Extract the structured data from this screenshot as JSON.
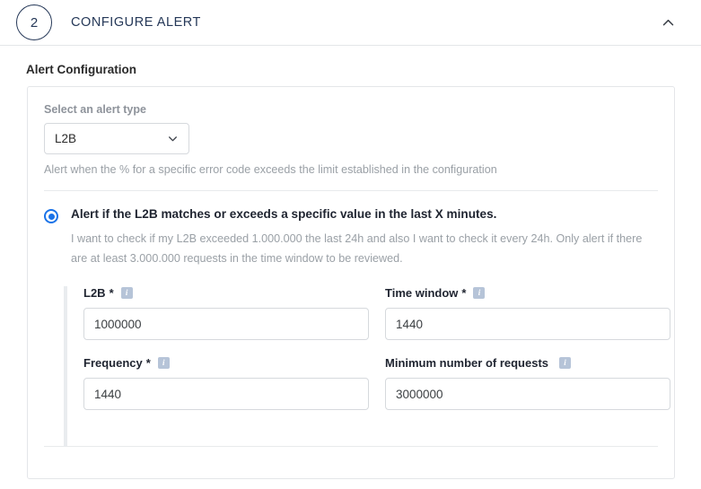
{
  "step": {
    "number": "2",
    "title": "CONFIGURE ALERT",
    "collapse_icon": "chevron-up-icon"
  },
  "section": {
    "title": "Alert Configuration"
  },
  "alert_type": {
    "label": "Select an alert type",
    "selected": "L2B",
    "caret_icon": "chevron-down-icon",
    "helper_text": "Alert when the % for a specific error code exceeds the limit established in the configuration",
    "options": [
      "L2B"
    ]
  },
  "radio_option": {
    "selected": true,
    "label": "Alert if the L2B matches or exceeds a specific value in the last X minutes.",
    "description": "I want to check if my L2B exceeded 1.000.000 the last 24h and also I want to check it every 24h. Only alert if there are at least 3.000.000 requests in the time window to be reviewed."
  },
  "fields": [
    {
      "label": "L2B",
      "required": true,
      "required_mark": "*",
      "info_icon": "info-icon",
      "info_glyph": "i",
      "value": "1000000",
      "name": "l2b"
    },
    {
      "label": "Time window",
      "required": true,
      "required_mark": "*",
      "info_icon": "info-icon",
      "info_glyph": "i",
      "value": "1440",
      "name": "time-window"
    },
    {
      "label": "Frequency",
      "required": true,
      "required_mark": "*",
      "info_icon": "info-icon",
      "info_glyph": "i",
      "value": "1440",
      "name": "frequency"
    },
    {
      "label": "Minimum number of requests",
      "required": false,
      "required_mark": "",
      "info_icon": "info-icon",
      "info_glyph": "i",
      "value": "3000000",
      "name": "minimum-number-of-requests"
    }
  ],
  "colors": {
    "accent_blue": "#1a73e8",
    "header_navy": "#253858",
    "border_gray": "#e4e6e9",
    "muted_text": "#9aa0a6",
    "info_badge": "#b6c4d8"
  }
}
